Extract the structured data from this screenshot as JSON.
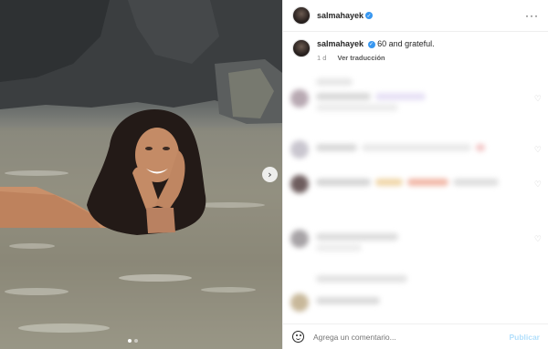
{
  "post": {
    "username": "salmahayek",
    "more_label": "···",
    "next_arrow": "›",
    "carousel": {
      "count": 2,
      "active": 1
    }
  },
  "caption": {
    "username": "salmahayek",
    "text": "60 and grateful.",
    "time": "1 d",
    "translate": "Ver traducción"
  },
  "comment_box": {
    "placeholder": "Agrega un comentario...",
    "publish": "Publicar"
  },
  "colors": {
    "verified": "#3897f0",
    "publish": "#b2dffc"
  },
  "icons": [
    "verified-badge-icon",
    "more-options-icon",
    "chevron-right-icon",
    "emoji-icon",
    "heart-icon"
  ]
}
